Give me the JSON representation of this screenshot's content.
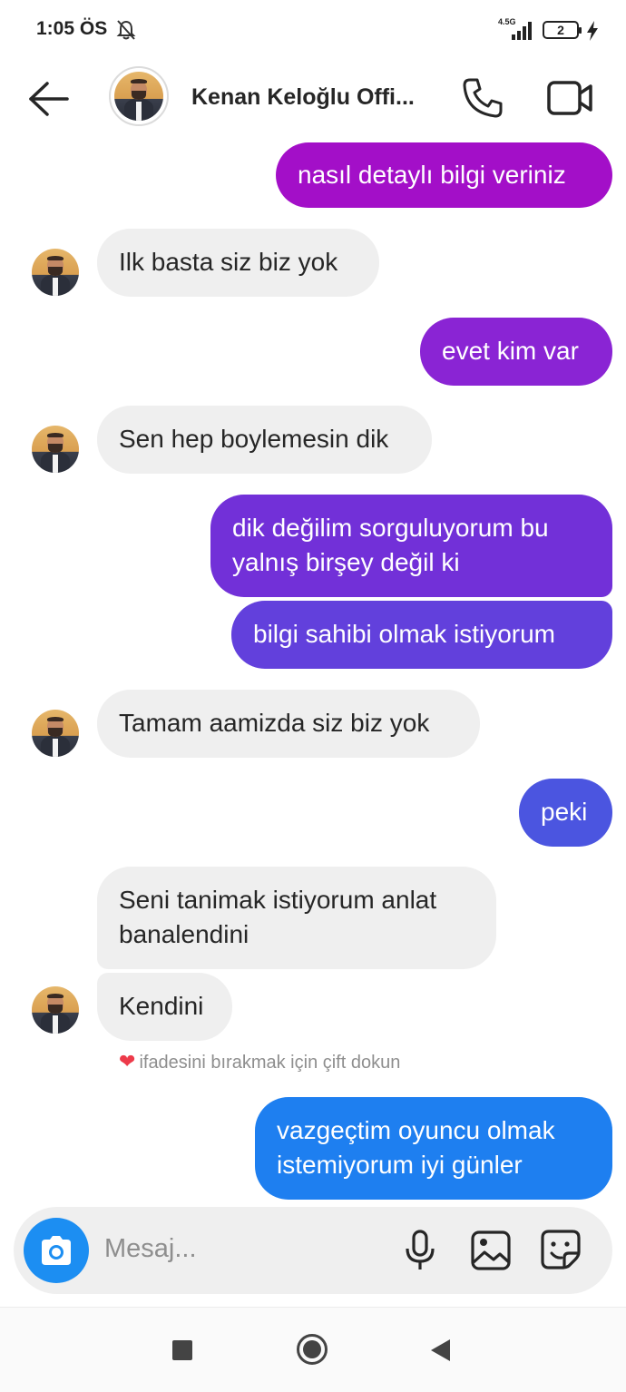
{
  "status_bar": {
    "time": "1:05 ÖS",
    "network": "4.5G",
    "battery": "2"
  },
  "header": {
    "contact_name": "Kenan Keloğlu Offi..."
  },
  "colors": {
    "incoming_bubble": "#efefef",
    "accent_blue": "#1c8ef2",
    "outgoing_gradient": [
      "#a30fc8",
      "#8a24d4",
      "#6a34d8",
      "#4b55e0",
      "#1e7ff0"
    ]
  },
  "messages": [
    {
      "side": "out",
      "text": [
        "nasıl detaylı bilgi veriniz"
      ],
      "color": "#a30fc8"
    },
    {
      "side": "in",
      "text": [
        "Ilk basta siz biz yok"
      ]
    },
    {
      "side": "out",
      "text": [
        "evet kim var"
      ],
      "color": "#8a24d4"
    },
    {
      "side": "in",
      "text": [
        "Sen hep boylemesin dik"
      ]
    },
    {
      "side": "out",
      "text": [
        "dik değilim sorguluyorum bu",
        "yalnış birşey değil ki"
      ],
      "color": "#7230d8"
    },
    {
      "side": "out",
      "text": [
        "bilgi sahibi olmak istiyorum"
      ],
      "color": "#6240dc"
    },
    {
      "side": "in",
      "text": [
        "Tamam aamizda siz biz yok"
      ]
    },
    {
      "side": "out",
      "text": [
        "peki"
      ],
      "color": "#4b55e0"
    },
    {
      "side": "in",
      "text": [
        "Seni tanimak istiyorum anlat",
        "banalendini"
      ]
    },
    {
      "side": "in",
      "text": [
        "Kendini"
      ]
    },
    {
      "side": "out",
      "text": [
        "vazgeçtim oyuncu olmak",
        "istemiyorum iyi günler"
      ],
      "color": "#1e7ff0"
    }
  ],
  "reaction_hint": "ifadesini bırakmak için çift dokun",
  "composer": {
    "placeholder": "Mesaj..."
  },
  "icons": {
    "header": [
      "back-arrow-icon",
      "phone-icon",
      "video-camera-icon"
    ],
    "composer": [
      "camera-icon",
      "microphone-icon",
      "gallery-icon",
      "sticker-icon"
    ],
    "navigation": [
      "recents-square-icon",
      "home-circle-icon",
      "back-triangle-icon"
    ]
  }
}
